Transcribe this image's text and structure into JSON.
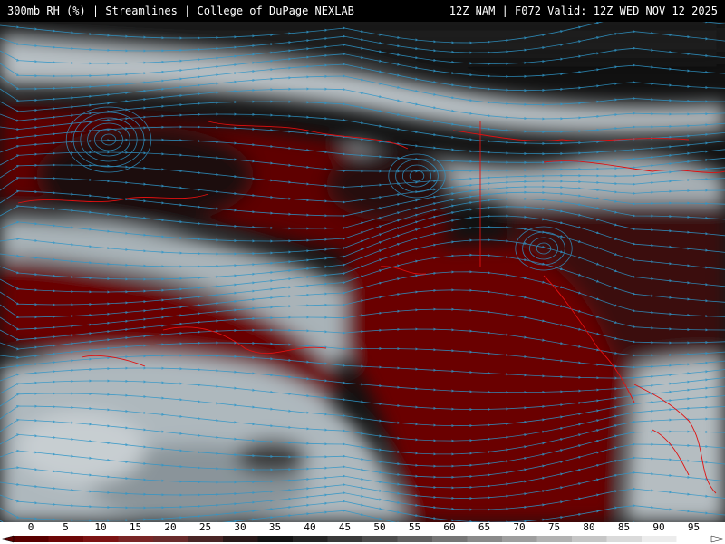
{
  "header": {
    "title_left": "300mb RH (%) | Streamlines | College of DuPage NEXLAB",
    "title_right": "12Z NAM | F072 Valid: 12Z WED NOV 12 2025"
  },
  "legend": {
    "ticks": [
      "0",
      "5",
      "10",
      "15",
      "20",
      "25",
      "30",
      "35",
      "40",
      "45",
      "50",
      "55",
      "60",
      "65",
      "70",
      "75",
      "80",
      "85",
      "90",
      "95"
    ],
    "colors": [
      "#5a0000",
      "#6e0808",
      "#7d1414",
      "#7a2626",
      "#6a2c2c",
      "#4a2626",
      "#2a1a1a",
      "#141414",
      "#262626",
      "#3a3a3a",
      "#4e4e4e",
      "#626262",
      "#767676",
      "#8a8a8a",
      "#9e9e9e",
      "#b2b2b2",
      "#c6c6c6",
      "#dadada",
      "#ececec",
      "#ffffff"
    ]
  },
  "map": {
    "fill_colors": {
      "dry": "#6b0606",
      "very_dry": "#4a0000",
      "mid": "#1a1a1a",
      "moist": "#9aa3a8",
      "saturated": "#e6eaec"
    },
    "streamline_color": "#2f96c8",
    "coastline_color": "#e01010"
  }
}
